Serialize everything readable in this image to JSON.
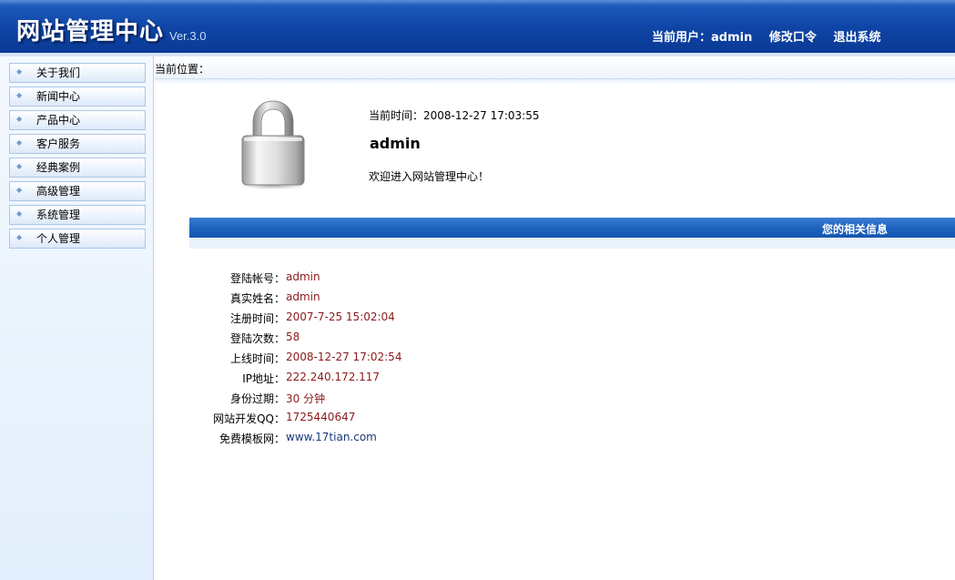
{
  "header": {
    "title": "网站管理中心",
    "version": "Ver.3.0",
    "current_user_label": "当前用户：",
    "current_user": "admin",
    "change_password": "修改口令",
    "logout": "退出系统"
  },
  "sidebar": {
    "items": [
      {
        "label": "关于我们"
      },
      {
        "label": "新闻中心"
      },
      {
        "label": "产品中心"
      },
      {
        "label": "客户服务"
      },
      {
        "label": "经典案例"
      },
      {
        "label": "高级管理"
      },
      {
        "label": "系统管理"
      },
      {
        "label": "个人管理"
      }
    ]
  },
  "breadcrumb": {
    "label": "当前位置："
  },
  "welcome": {
    "time_label": "当前时间：",
    "time_value": "2008-12-27 17:03:55",
    "username": "admin",
    "message": "欢迎进入网站管理中心！"
  },
  "info": {
    "title": "您的相关信息",
    "rows": [
      {
        "key": "登陆帐号：",
        "value": "admin"
      },
      {
        "key": "真实姓名：",
        "value": "admin"
      },
      {
        "key": "注册时间：",
        "value": "2007-7-25 15:02:04"
      },
      {
        "key": "登陆次数：",
        "value": "58"
      },
      {
        "key": "上线时间：",
        "value": "2008-12-27 17:02:54"
      },
      {
        "key": "IP地址：",
        "value": "222.240.172.117"
      },
      {
        "key": "身份过期：",
        "value": "30 分钟"
      },
      {
        "key": "网站开发QQ：",
        "value": "1725440647"
      },
      {
        "key": "免费模板网：",
        "value": "www.17tian.com"
      }
    ]
  },
  "icons": {
    "lock": "lock-icon",
    "bullet": "diamond-bullet-icon"
  }
}
